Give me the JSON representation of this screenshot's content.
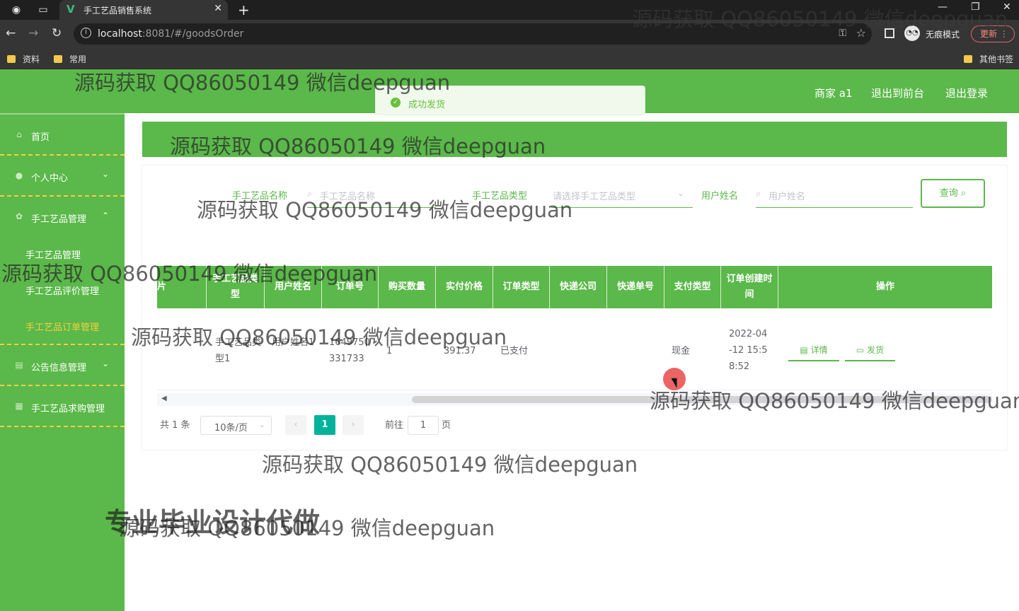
{
  "browser": {
    "tab_title": "手工艺品销售系统",
    "url_host": "localhost",
    "url_rest": ":8081/#/goodsOrder",
    "incognito_label": "无痕模式",
    "update_label": "更新",
    "bookmarks": [
      "资料",
      "常用"
    ],
    "other_bookmarks": "其他书签"
  },
  "header": {
    "user": "商家 a1",
    "to_front": "退出到前台",
    "logout": "退出登录"
  },
  "toast": {
    "message": "成功发货"
  },
  "sidebar": {
    "home": "首页",
    "personal": "个人中心",
    "craft_mgmt": "手工艺品管理",
    "sub_items": [
      "手工艺品管理",
      "手工艺品评价管理",
      "手工艺品订单管理"
    ],
    "notice": "公告信息管理",
    "purchase": "手工艺品求购管理"
  },
  "search": {
    "name_label": "手工艺品名称",
    "name_placeholder": "手工艺品名称",
    "type_label": "手工艺品类型",
    "type_placeholder": "请选择手工艺品类型",
    "user_label": "用户姓名",
    "user_placeholder": "用户姓名",
    "query_button": "查询"
  },
  "table": {
    "headers": [
      "片",
      "手工艺品类型",
      "用户姓名",
      "订单号",
      "购买数量",
      "实付价格",
      "订单类型",
      "快递公司",
      "快递单号",
      "支付类型",
      "订单创建时间",
      "操作"
    ],
    "row": {
      "type": "手工艺品类型1",
      "user": "用户姓名1",
      "order_no": "1649750331733",
      "qty": "1",
      "price": "391.37",
      "order_type": "已支付",
      "courier": "",
      "tracking": "",
      "pay_type": "现金",
      "created": "2022-04-12 15:58:52",
      "detail_btn": "详情",
      "ship_btn": "发货"
    }
  },
  "pagination": {
    "total": "共 1 条",
    "page_size": "10条/页",
    "current": "1",
    "goto_label": "前往",
    "goto_value": "1",
    "page_suffix": "页"
  },
  "watermark": {
    "text": "源码获取 QQ86050149 微信deepguan",
    "big_text": "专业毕业设计代做"
  }
}
